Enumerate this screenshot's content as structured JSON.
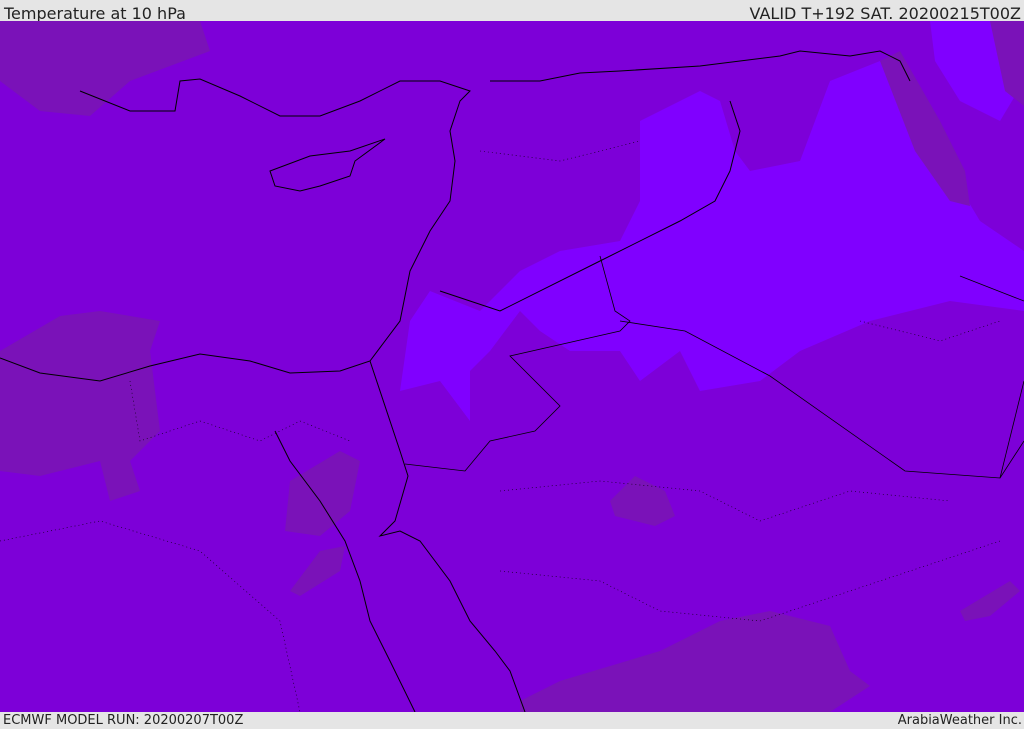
{
  "header": {
    "title": "Temperature at 10 hPa",
    "valid": "VALID T+192 SAT. 20200215T00Z"
  },
  "footer": {
    "model_run": "ECMWF MODEL RUN: 20200207T00Z",
    "brand": "ArabiaWeather Inc."
  },
  "colors": {
    "base": "#7d00d8",
    "warm_light": "#8000ff",
    "cool_dark": "#7a12b8",
    "coast": "#000000"
  }
}
